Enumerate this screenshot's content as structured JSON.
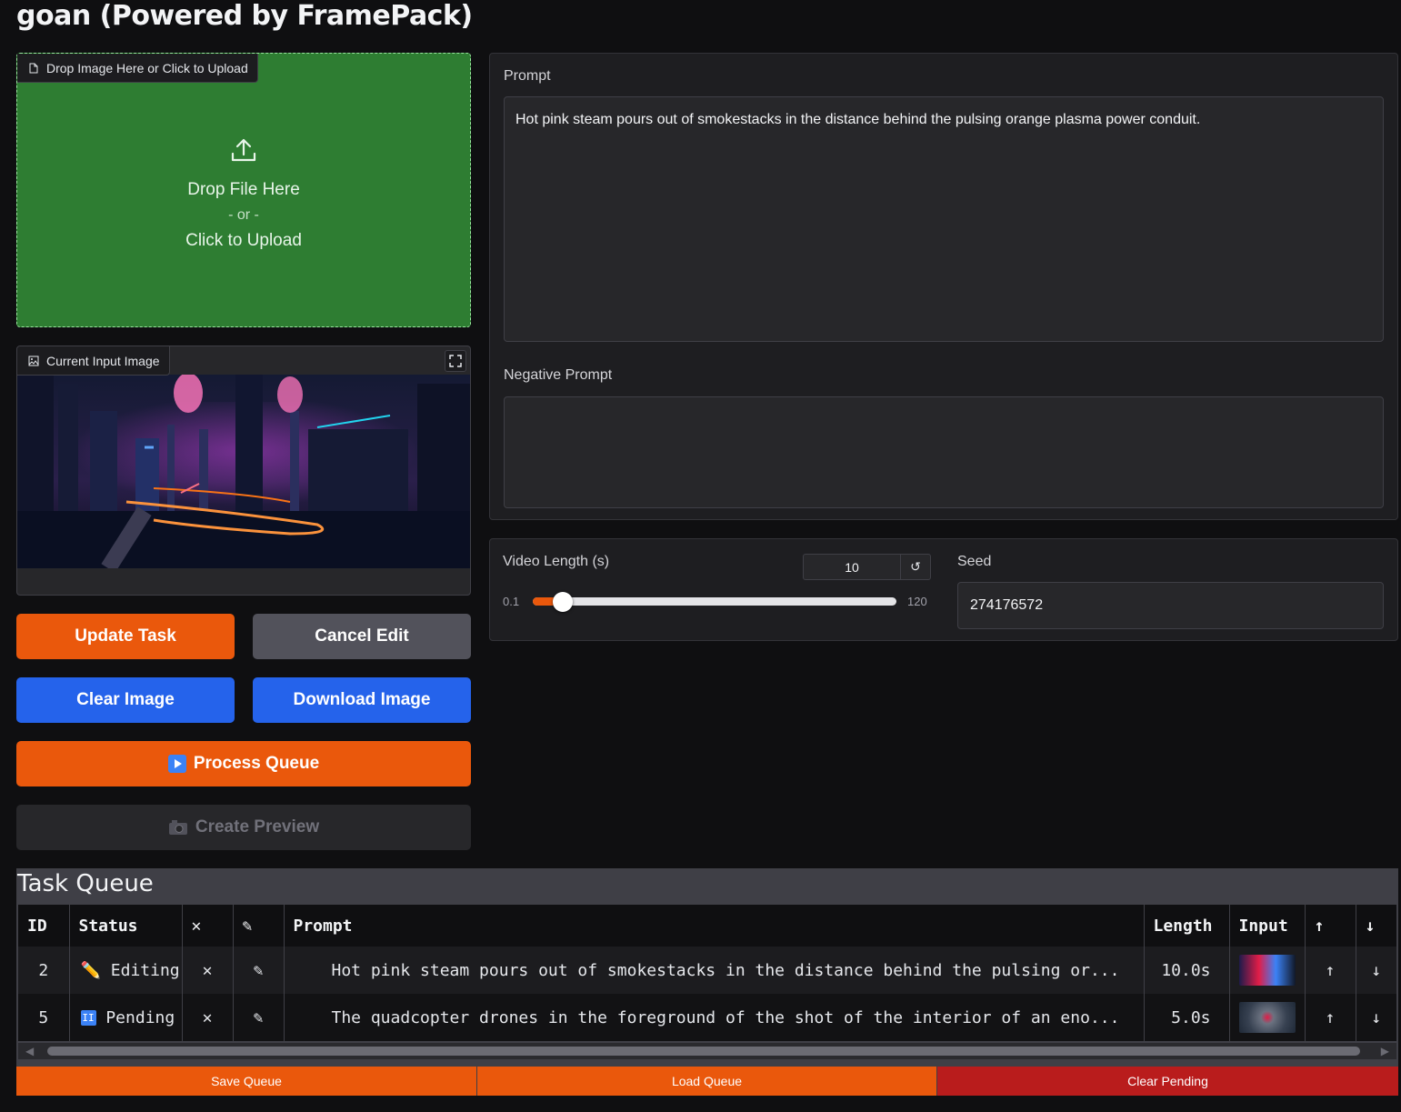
{
  "app": {
    "title": "goan (Powered by FramePack)"
  },
  "upload": {
    "tag_label": "Drop Image Here or Click to Upload",
    "drop_text": "Drop File Here",
    "or_text": "- or -",
    "click_text": "Click to Upload"
  },
  "current_image": {
    "tag_label": "Current Input Image"
  },
  "buttons": {
    "update_task": "Update Task",
    "cancel_edit": "Cancel Edit",
    "clear_image": "Clear Image",
    "download_image": "Download Image",
    "process_queue": "Process Queue",
    "create_preview": "Create Preview"
  },
  "prompt": {
    "label": "Prompt",
    "value": "Hot pink steam pours out of smokestacks in the distance behind the pulsing orange plasma power conduit."
  },
  "negative_prompt": {
    "label": "Negative Prompt",
    "value": ""
  },
  "video_length": {
    "label": "Video Length (s)",
    "value": "10",
    "min": "0.1",
    "max": "120",
    "fraction": 0.083
  },
  "seed": {
    "label": "Seed",
    "value": "274176572"
  },
  "queue": {
    "title": "Task Queue",
    "columns": [
      "ID",
      "Status",
      "✕",
      "✎",
      "Prompt",
      "Length",
      "Input",
      "↑",
      "↓"
    ],
    "rows": [
      {
        "id": "2",
        "status_icon": "pencil-icon",
        "status": "Editing",
        "remove": "✕",
        "edit": "✎",
        "prompt": "Hot pink steam pours out of smokestacks in the distance behind the pulsing or...",
        "length": "10.0s",
        "up": "↑",
        "down": "↓"
      },
      {
        "id": "5",
        "status_icon": "pause-icon",
        "status": "Pending",
        "remove": "✕",
        "edit": "✎",
        "prompt": "The quadcopter drones in the foreground of the shot of the interior of an eno...",
        "length": "5.0s",
        "up": "↑",
        "down": "↓"
      }
    ],
    "save_label": "Save Queue",
    "load_label": "Load Queue",
    "clear_label": "Clear Pending"
  },
  "colors": {
    "primary": "#ea580c",
    "secondary": "#2563eb",
    "stop": "#b91c1c",
    "upload_bg": "#2e7d32"
  }
}
